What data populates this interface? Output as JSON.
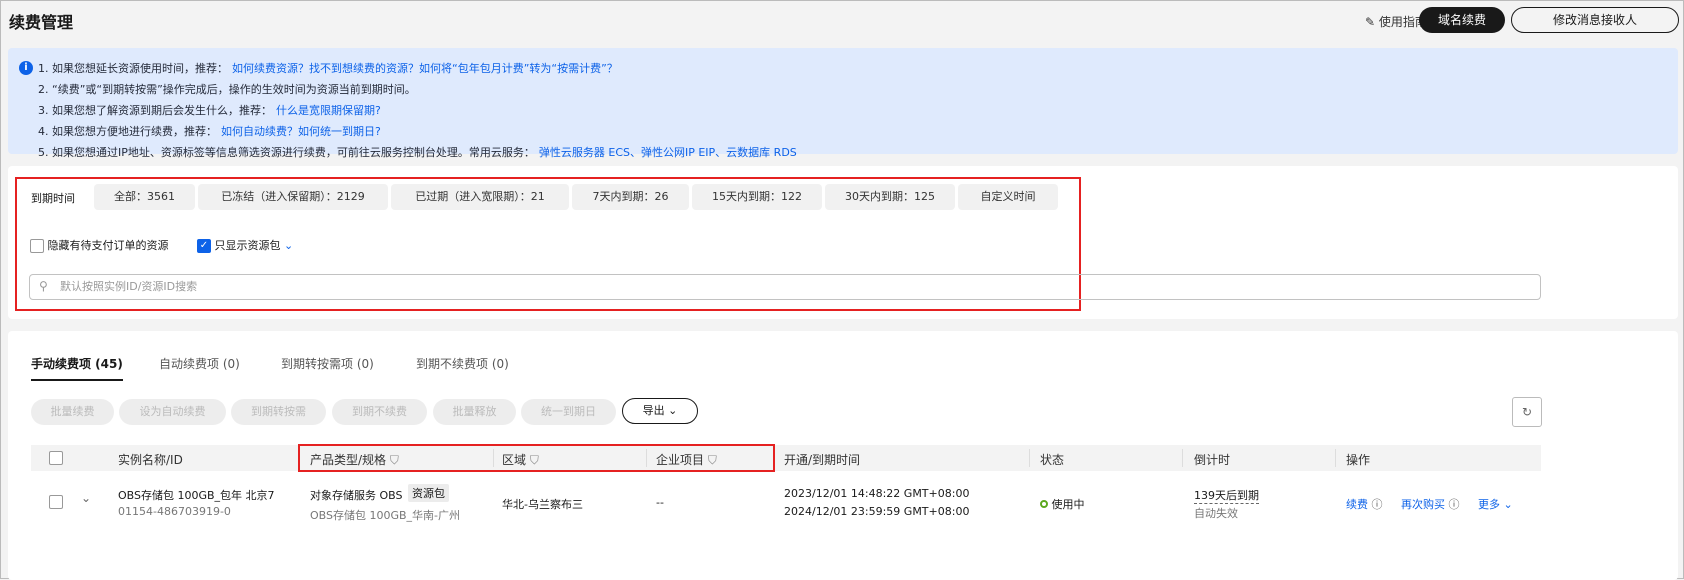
{
  "header": {
    "title": "续费管理",
    "guide": "使用指南",
    "domain_renew": "域名续费",
    "modify_receiver": "修改消息接收人"
  },
  "info": {
    "l1": "1. 如果您想延长资源使用时间，推荐：",
    "l1_link": "如何续费资源？找不到想续费的资源？如何将“包年包月计费”转为“按需计费”？",
    "l2": "2. “续费”或“到期转按需”操作完成后，操作的生效时间为资源当前到期时间。",
    "l3": "3. 如果您想了解资源到期后会发生什么，推荐：",
    "l3_link": "什么是宽限期保留期?",
    "l4": "4. 如果您想方便地进行续费，推荐：",
    "l4_link": "如何自动续费？如何统一到期日?",
    "l5": "5. 如果您想通过IP地址、资源标签等信息筛选资源进行续费，可前往云服务控制台处理。常用云服务：",
    "l5_link": "弹性云服务器 ECS、弹性公网IP EIP、云数据库 RDS"
  },
  "filter": {
    "label": "到期时间",
    "chips": [
      "全部：3561",
      "已冻结（进入保留期）：2129",
      "已过期（进入宽限期）：21",
      "7天内到期：26",
      "15天内到期：122",
      "30天内到期：125",
      "自定义时间"
    ],
    "hide_unpaid": "隐藏有待支付订单的资源",
    "only_package": "只显示资源包",
    "search_placeholder": "默认按照实例ID/资源ID搜索"
  },
  "tabs": [
    "手动续费项 (45)",
    "自动续费项 (0)",
    "到期转按需项 (0)",
    "到期不续费项 (0)"
  ],
  "actions": [
    "批量续费",
    "设为自动续费",
    "到期转按需",
    "到期不续费",
    "批量释放",
    "统一到期日"
  ],
  "export": "导出",
  "table": {
    "headers": [
      "实例名称/ID",
      "产品类型/规格",
      "区域",
      "企业项目",
      "开通/到期时间",
      "状态",
      "倒计时",
      "操作"
    ],
    "rows": [
      {
        "name": "OBS存储包 100GB_包年 北京7",
        "id": "01154-486703919-0",
        "product": "对象存储服务 OBS",
        "tag": "资源包",
        "spec": "OBS存储包 100GB_华南-广州",
        "region": "华北-乌兰察布三",
        "project": "--",
        "start": "2023/12/01 14:48:22 GMT+08:00",
        "end": "2024/12/01 23:59:59 GMT+08:00",
        "status": "使用中",
        "countdown": "139天后到期",
        "countdown_sub": "自动失效",
        "op_renew": "续费",
        "op_rebuy": "再次购买",
        "op_more": "更多"
      }
    ]
  }
}
